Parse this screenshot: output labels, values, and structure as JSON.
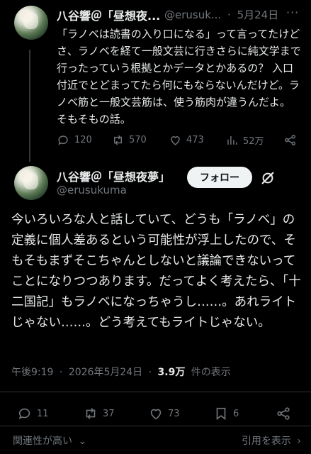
{
  "reply_tweet": {
    "author_name": "八谷響＠「昼想夜...",
    "handle": "@erusuk...",
    "dot": "·",
    "date": "5月24日",
    "more": "···",
    "text": "「ラノベは読書の入り口になる」って言ってたけどさ、ラノベを経て一般文芸に行きさらに純文学まで行ったっていう根拠とかデータとかあるの？ 入口付近でとどまってたら何にもならないんだけど。ラノベ筋と一般文芸筋は、使う筋肉が違うんだよ。そもそもの話。",
    "stats": {
      "replies": "120",
      "retweets": "570",
      "likes": "473",
      "views": "52万"
    }
  },
  "main_tweet": {
    "author_name": "八谷響＠「昼想夜夢」",
    "handle": "@erusukuma",
    "follow_label": "フォロー",
    "text": "今いろいろな人と話していて、どうも「ラノベ」の定義に個人差あるという可能性が浮上したので、そもそもまずそこちゃんとしないと議論できないってことになりつつあります。だってよく考えたら、「十二国記」もラノベになっちゃうし……。あれライトじゃない……。どう考えてもライトじゃない。",
    "time": "午後9:19",
    "dot": "·",
    "date": "2026年5月24日",
    "views_count": "3.9万",
    "views_label": "件の表示",
    "stats": {
      "replies": "11",
      "retweets": "37",
      "likes": "73",
      "bookmarks": "6"
    }
  },
  "footer": {
    "sort_label": "関連性が高い",
    "sort_caret": "⌄",
    "quotes_label": "引用を表示",
    "quotes_arrow": "›"
  },
  "colors": {
    "background": "#000000",
    "text": "#e7e9ea",
    "muted": "#71767b",
    "divider": "#2f3336"
  }
}
